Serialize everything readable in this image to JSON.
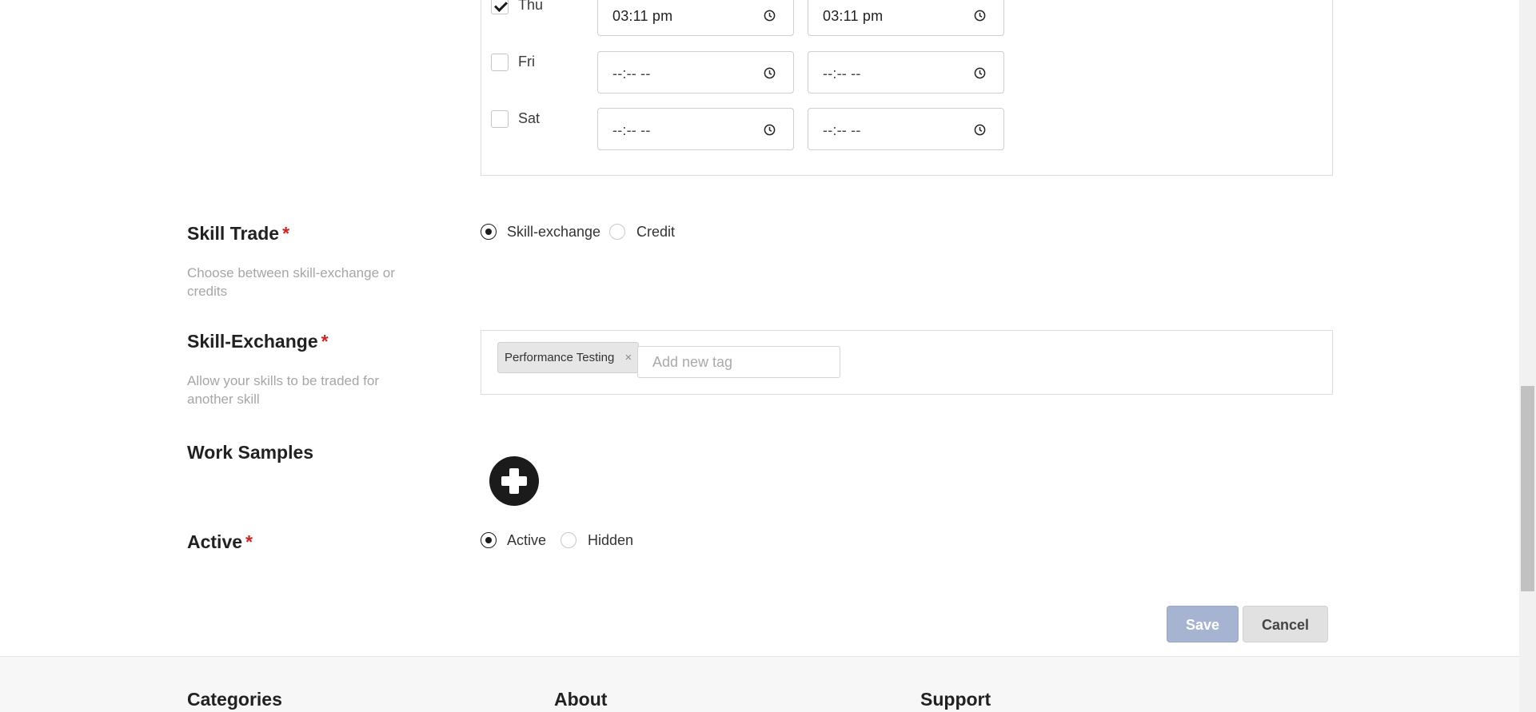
{
  "availability": {
    "rows": [
      {
        "day": "Thu",
        "checked": true,
        "from": "03:11 pm",
        "to": "03:11 pm"
      },
      {
        "day": "Fri",
        "checked": false,
        "from": "--:-- --",
        "to": "--:-- --"
      },
      {
        "day": "Sat",
        "checked": false,
        "from": "--:-- --",
        "to": "--:-- --"
      }
    ]
  },
  "skill_trade": {
    "label": "Skill Trade",
    "required_mark": "*",
    "help": "Choose between skill-exchange or credits",
    "options": [
      "Skill-exchange",
      "Credit"
    ],
    "selected": "Skill-exchange"
  },
  "skill_exchange": {
    "label": "Skill-Exchange",
    "required_mark": "*",
    "help": "Allow your skills to be traded for another skill",
    "tags": [
      "Performance Testing"
    ],
    "tag_remove": "×",
    "input_placeholder": "Add new tag"
  },
  "work_samples": {
    "label": "Work Samples",
    "add_icon": "plus-circle-icon"
  },
  "active": {
    "label": "Active",
    "required_mark": "*",
    "options": [
      "Active",
      "Hidden"
    ],
    "selected": "Active"
  },
  "actions": {
    "save_label": "Save",
    "cancel_label": "Cancel"
  },
  "footer": {
    "headings": [
      "Categories",
      "About",
      "Support"
    ]
  },
  "colors": {
    "required": "#c62828",
    "save_button": "#a7b4d1",
    "cancel_button": "#e1e1e1",
    "text": "#212121",
    "help_text": "#a6a6a6"
  }
}
